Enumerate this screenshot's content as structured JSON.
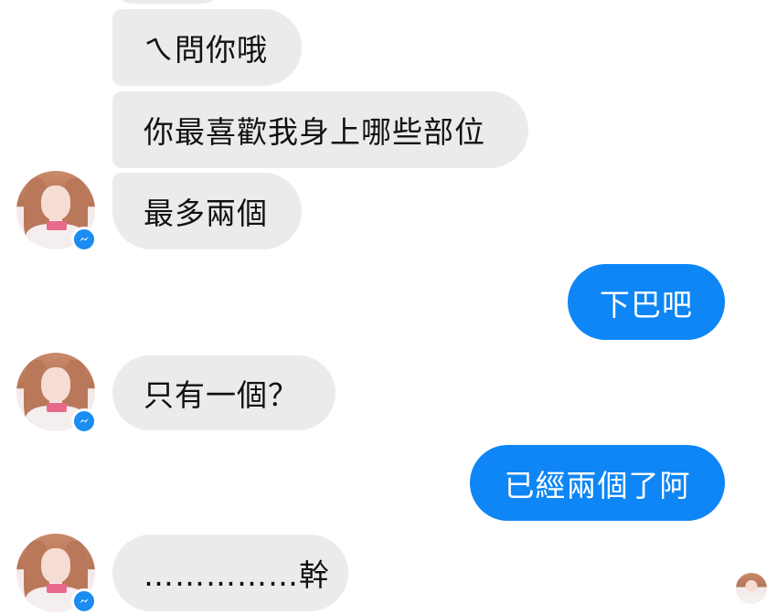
{
  "conversation": {
    "messages": [
      {
        "id": "m1",
        "direction": "incoming",
        "text": "ㄟ問你哦"
      },
      {
        "id": "m2",
        "direction": "incoming",
        "text": "你最喜歡我身上哪些部位"
      },
      {
        "id": "m3",
        "direction": "incoming",
        "text": "最多兩個"
      },
      {
        "id": "m4",
        "direction": "outgoing",
        "text": "下巴吧"
      },
      {
        "id": "m5",
        "direction": "incoming",
        "text": "只有一個？"
      },
      {
        "id": "m6",
        "direction": "outgoing",
        "text": "已經兩個了阿"
      },
      {
        "id": "m7",
        "direction": "incoming",
        "text": "……………幹"
      }
    ]
  },
  "contact": {
    "avatar_icon": "contact-avatar-photo",
    "badge_icon": "messenger-icon"
  },
  "theme": {
    "incoming_bubble": "#ebebeb",
    "outgoing_bubble": "#0e86f5",
    "badge": "#1a8cf2"
  }
}
